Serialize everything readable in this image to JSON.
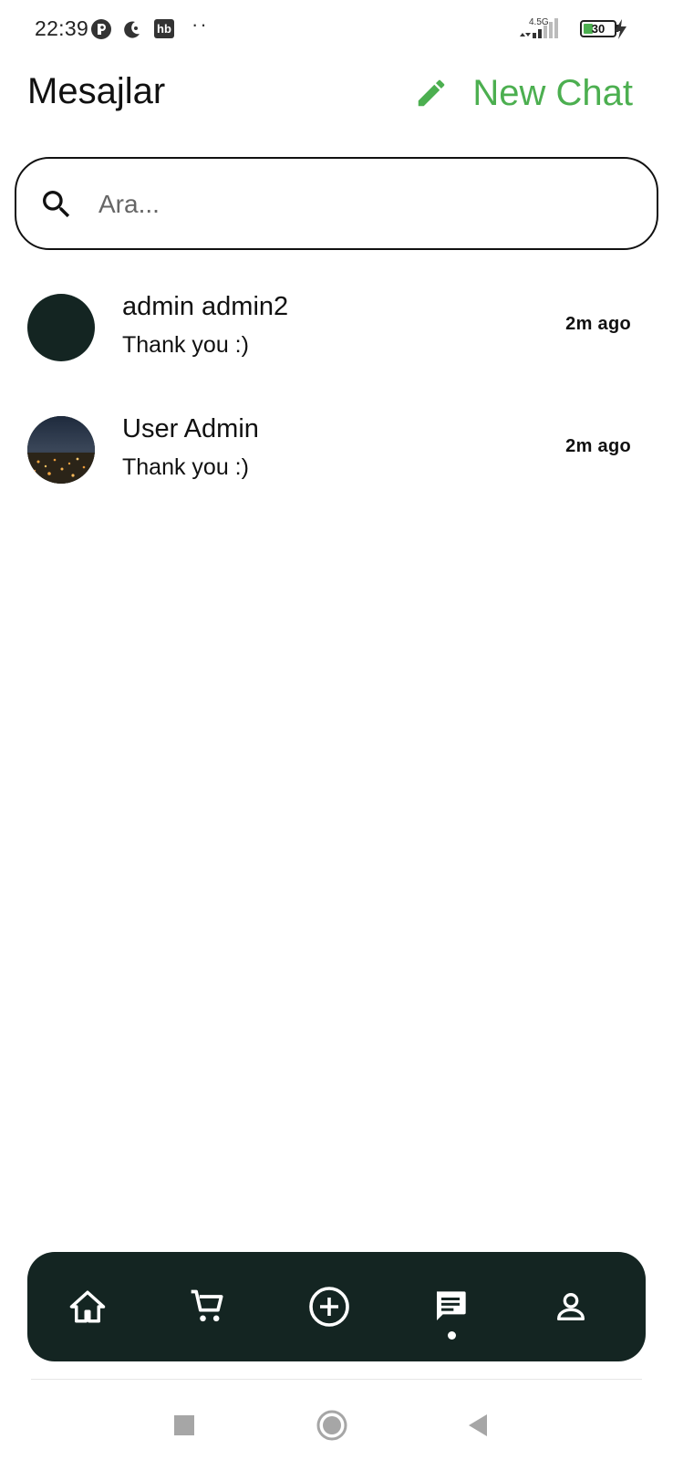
{
  "status_bar": {
    "time": "22:39",
    "notification_badge": "hb",
    "overflow_dots": "··",
    "network_label": "4.5G",
    "battery_percent": 30,
    "battery_text": "30",
    "battery_color": "#4caf50"
  },
  "header": {
    "title": "Mesajlar",
    "new_chat_label": "New Chat",
    "accent_color": "#4caf50"
  },
  "search": {
    "placeholder": "Ara...",
    "value": ""
  },
  "chats": [
    {
      "name": "admin admin2",
      "preview": "Thank you :)",
      "time": "2m ago",
      "avatar": "plain-dark-avatar"
    },
    {
      "name": "User Admin",
      "preview": "Thank you :)",
      "time": "2m ago",
      "avatar": "night-city-photo"
    }
  ],
  "bottom_nav": {
    "background": "#142522",
    "items": [
      {
        "icon": "home-icon",
        "active": false
      },
      {
        "icon": "cart-icon",
        "active": false
      },
      {
        "icon": "add-circle-icon",
        "active": false
      },
      {
        "icon": "messages-icon",
        "active": true
      },
      {
        "icon": "profile-icon",
        "active": false
      }
    ]
  },
  "system_nav": {
    "items": [
      "recents-square-icon",
      "home-circle-icon",
      "back-triangle-icon"
    ]
  }
}
